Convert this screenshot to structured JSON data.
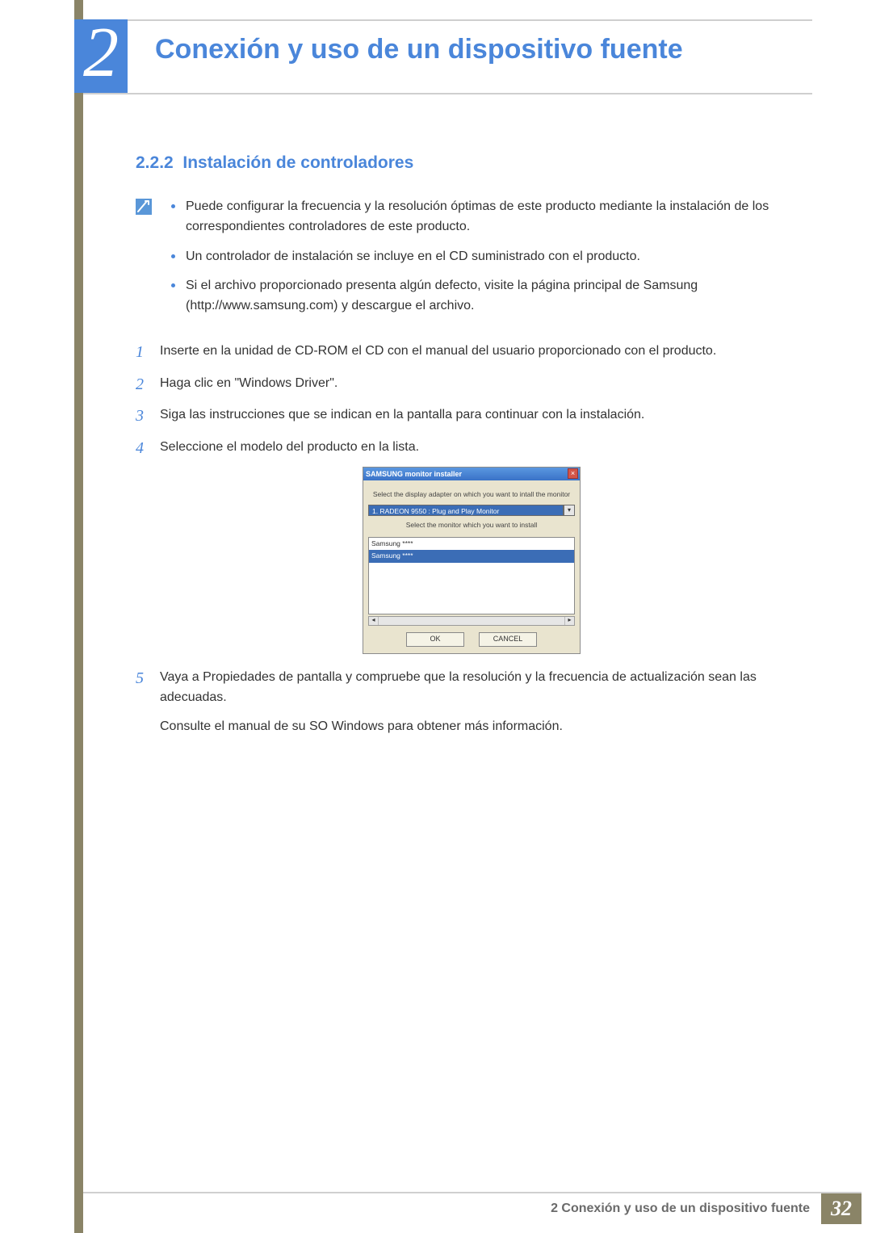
{
  "chapter": {
    "number": "2",
    "title": "Conexión y uso de un dispositivo fuente"
  },
  "section": {
    "number": "2.2.2",
    "title": "Instalación de controladores"
  },
  "notes": [
    "Puede configurar la frecuencia y la resolución óptimas de este producto mediante la instalación de los correspondientes controladores de este producto.",
    "Un controlador de instalación se incluye en el CD suministrado con el producto.",
    "Si el archivo proporcionado presenta algún defecto, visite la página principal de Samsung (http://www.samsung.com) y descargue el archivo."
  ],
  "steps": {
    "s1": "Inserte en la unidad de CD-ROM el CD con el manual del usuario proporcionado con el producto.",
    "s2": "Haga clic en \"Windows Driver\".",
    "s3": "Siga las instrucciones que se indican en la pantalla para continuar con la instalación.",
    "s4": "Seleccione el modelo del producto en la lista.",
    "s5": "Vaya a Propiedades de pantalla y compruebe que la resolución y la frecuencia de actualización sean las adecuadas.",
    "s5b": "Consulte el manual de su SO Windows para obtener más información."
  },
  "step_numbers": {
    "n1": "1",
    "n2": "2",
    "n3": "3",
    "n4": "4",
    "n5": "5"
  },
  "installer": {
    "title": "SAMSUNG monitor installer",
    "label_adapter": "Select the display adapter on which you want to intall the monitor",
    "adapter_selected": "1. RADEON 9550 : Plug and Play Monitor",
    "label_monitor": "Select the monitor which you want to install",
    "list_item_a": "Samsung ****",
    "list_item_b": "Samsung ****",
    "ok": "OK",
    "cancel": "CANCEL"
  },
  "footer": {
    "text": "2 Conexión y uso de un dispositivo fuente",
    "page": "32"
  }
}
